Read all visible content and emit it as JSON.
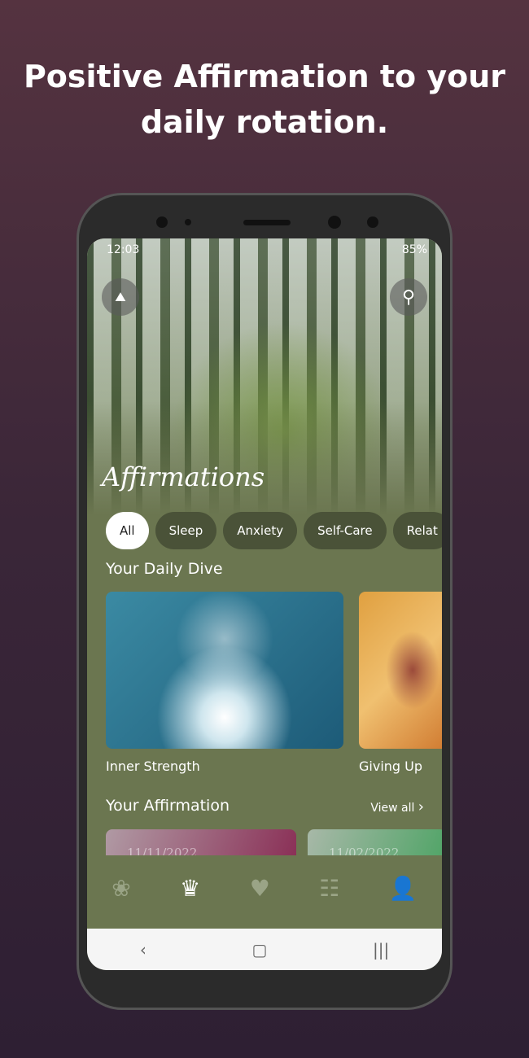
{
  "headline": "Positive Affirmation to your daily rotation.",
  "status": {
    "time": "12:03",
    "battery": "85%"
  },
  "app_title": "Affirmations",
  "categories": [
    {
      "label": "All",
      "active": true
    },
    {
      "label": "Sleep"
    },
    {
      "label": "Anxiety"
    },
    {
      "label": "Self-Care"
    },
    {
      "label": "Relat"
    }
  ],
  "daily_dive": {
    "title": "Your Daily Dive",
    "items": [
      {
        "label": "Inner Strength"
      },
      {
        "label": "Giving Up"
      }
    ]
  },
  "affirmation": {
    "title": "Your Affirmation",
    "view_all": "View all",
    "cards": [
      {
        "date": "11/11/2022"
      },
      {
        "date": "11/02/2022"
      }
    ]
  },
  "bottom_nav": [
    {
      "icon": "lotus-icon"
    },
    {
      "icon": "crown-icon",
      "active": true
    },
    {
      "icon": "heart-icon"
    },
    {
      "icon": "list-icon"
    },
    {
      "icon": "user-icon"
    }
  ]
}
